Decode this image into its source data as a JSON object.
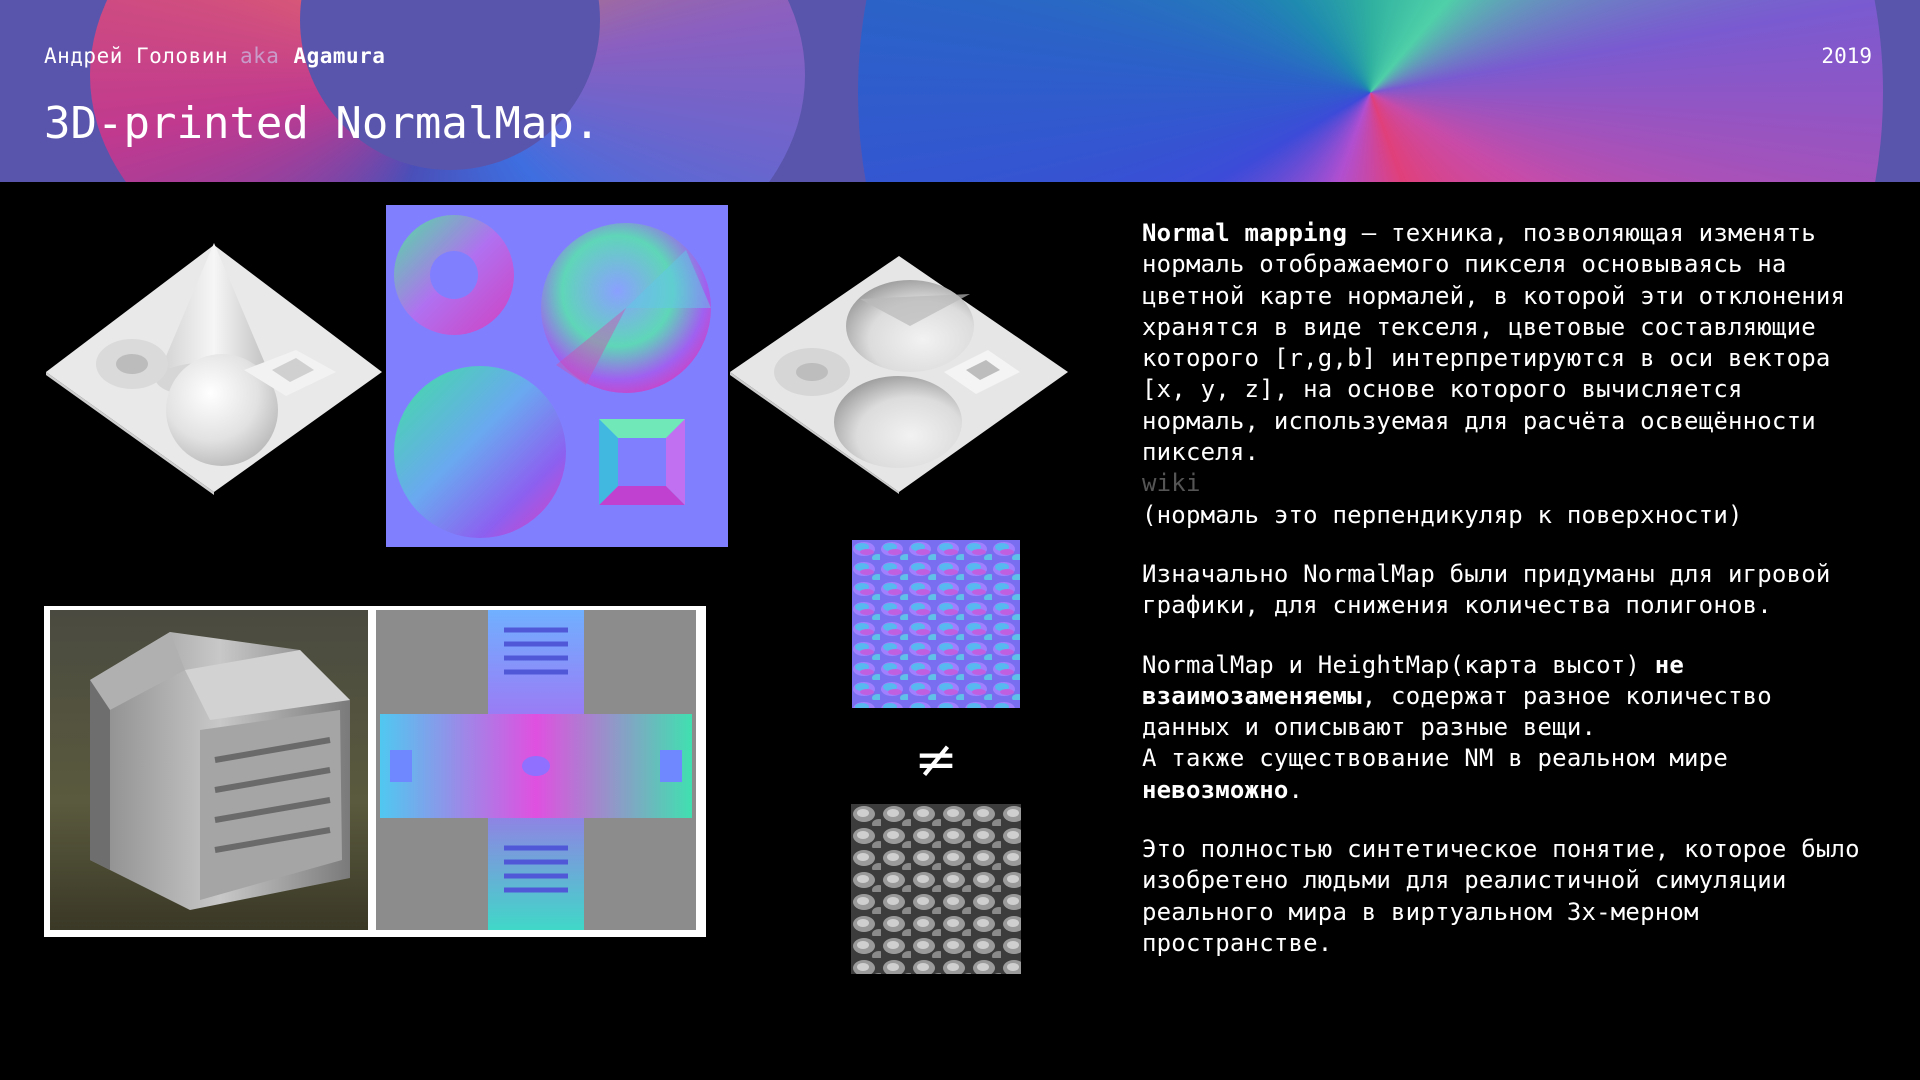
{
  "header": {
    "author_name": "Андрей Головин",
    "aka": "aka",
    "nickname": "Agamura",
    "year": "2019",
    "title": "3D-printed NormalMap."
  },
  "symbols": {
    "not_equal": "≠"
  },
  "text": {
    "p1_term": "Normal mapping",
    "p1_body": " — техника, позволяющая изменять нормаль отображаемого пикселя основываясь на цветной карте нормалей, в которой эти отклонения хранятся в виде текселя, цветовые составляющие которого [r,g,b] интерпретируются в оси вектора [x, y, z], на основе которого вычисляется нормаль, используемая для расчёта освещённости пикселя.",
    "wiki_link": "wiki",
    "p1_note": "(нормаль это перпендикуляр к поверхности)",
    "p2": "Изначально NormalMap были придуманы для игровой графики, для снижения количества полигонов.",
    "p3_start": "NormalMap и HeightMap(карта высот) ",
    "p3_bold": "не взаимозаменяемы",
    "p3_end": ", содержат разное количество данных и описывают разные вещи.",
    "p4_start": "А также существование NM в реальном мире ",
    "p4_bold": "невозможно",
    "p4_end": ".",
    "p5": "Это полностью синтетическое понятие, которое было изобретено людьми для реалистичной симуляции реального мира в виртуальном 3х-мерном пространстве."
  },
  "colors": {
    "background": "#000000",
    "header_bg": "#5a55ac",
    "normal_flat": "#8080ff",
    "wiki_link": "#555555"
  }
}
